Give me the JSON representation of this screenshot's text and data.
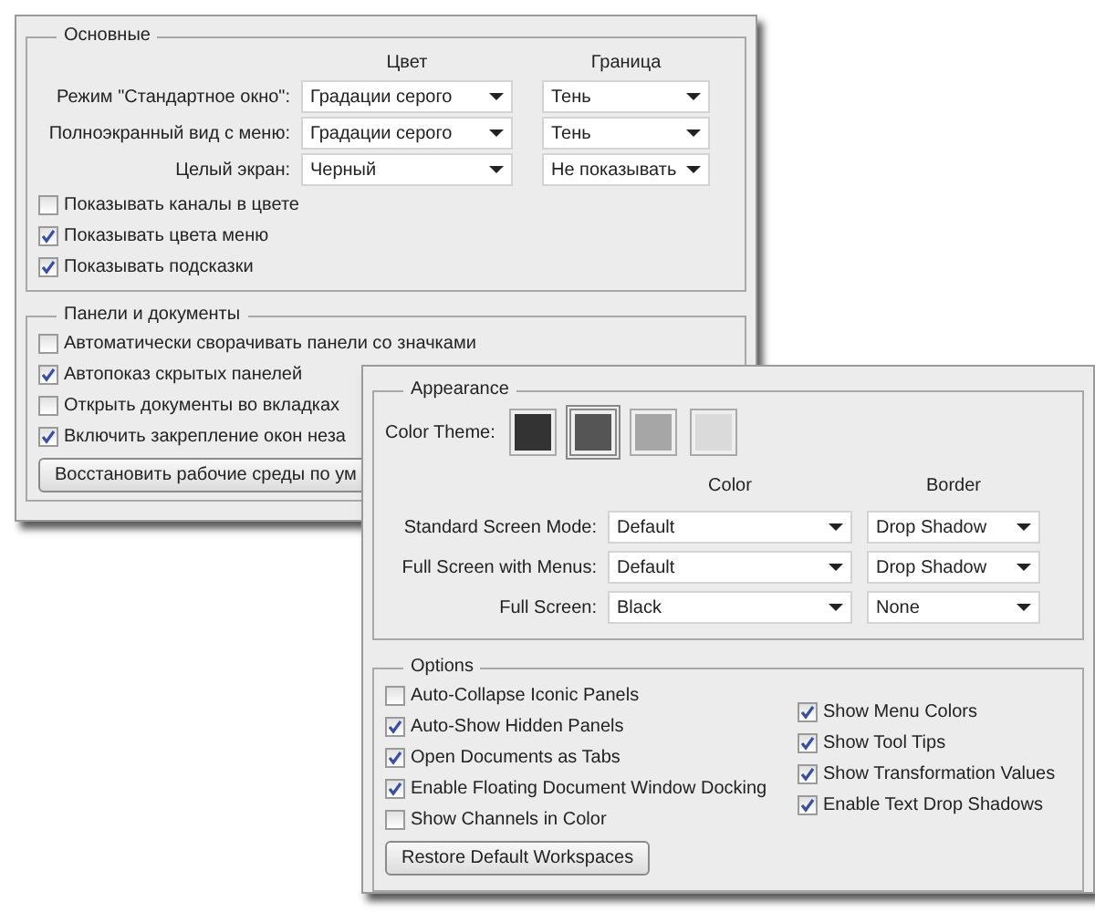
{
  "back_panel": {
    "sections": [
      {
        "title": "Основные",
        "headers": [
          "Цвет",
          "Граница"
        ],
        "selects": [
          {
            "label": "Режим \"Стандартное окно\":",
            "color_setting": "Градации серого",
            "border_setting": "Тень"
          },
          {
            "label": "Полноэкранный вид с меню:",
            "color_setting": "Градации серого",
            "border_setting": "Тень"
          },
          {
            "label": "Целый экран:",
            "color_setting": "Черный",
            "border_setting": "Не показывать"
          }
        ],
        "checkbox_columns": [
          [
            {
              "label": "Показывать каналы в цвете",
              "checked": false
            },
            {
              "label": "Показывать цвета меню",
              "checked": true
            },
            {
              "label": "Показывать подсказки",
              "checked": true
            }
          ]
        ]
      },
      {
        "title": "Панели и документы",
        "checkbox_columns": [
          [
            {
              "label": "Автоматически сворачивать панели со значками",
              "checked": false
            },
            {
              "label": "Автопоказ скрытых панелей",
              "checked": true
            },
            {
              "label": "Открыть документы во вкладках",
              "checked": false
            },
            {
              "label": "Включить закрепление окон неза",
              "checked": true
            }
          ]
        ],
        "button": "Восстановить рабочие среды по ум"
      }
    ]
  },
  "front_panel": {
    "sections": [
      {
        "title": "Appearance",
        "theme_label": "Color Theme:",
        "swatches": [
          {
            "color": "#333333",
            "selected": false
          },
          {
            "color": "#555555",
            "selected": true
          },
          {
            "color": "#a6a6a6",
            "selected": false
          },
          {
            "color": "#dadada",
            "selected": false
          }
        ],
        "headers": [
          "Color",
          "Border"
        ],
        "selects": [
          {
            "label": "Standard Screen Mode:",
            "color_setting": "Default",
            "border_setting": "Drop Shadow"
          },
          {
            "label": "Full Screen with Menus:",
            "color_setting": "Default",
            "border_setting": "Drop Shadow"
          },
          {
            "label": "Full Screen:",
            "color_setting": "Black",
            "border_setting": "None"
          }
        ]
      },
      {
        "title": "Options",
        "checkbox_columns": [
          [
            {
              "label": "Auto-Collapse Iconic Panels",
              "checked": false
            },
            {
              "label": "Auto-Show Hidden Panels",
              "checked": true
            },
            {
              "label": "Open Documents as Tabs",
              "checked": true
            },
            {
              "label": "Enable Floating Document Window Docking",
              "checked": true
            },
            {
              "label": "Show Channels in Color",
              "checked": false
            }
          ],
          [
            {
              "label": "Show Menu Colors",
              "checked": true
            },
            {
              "label": "Show Tool Tips",
              "checked": true
            },
            {
              "label": "Show Transformation Values",
              "checked": true
            },
            {
              "label": "Enable Text Drop Shadows",
              "checked": true
            }
          ]
        ],
        "button": "Restore Default Workspaces"
      }
    ]
  }
}
